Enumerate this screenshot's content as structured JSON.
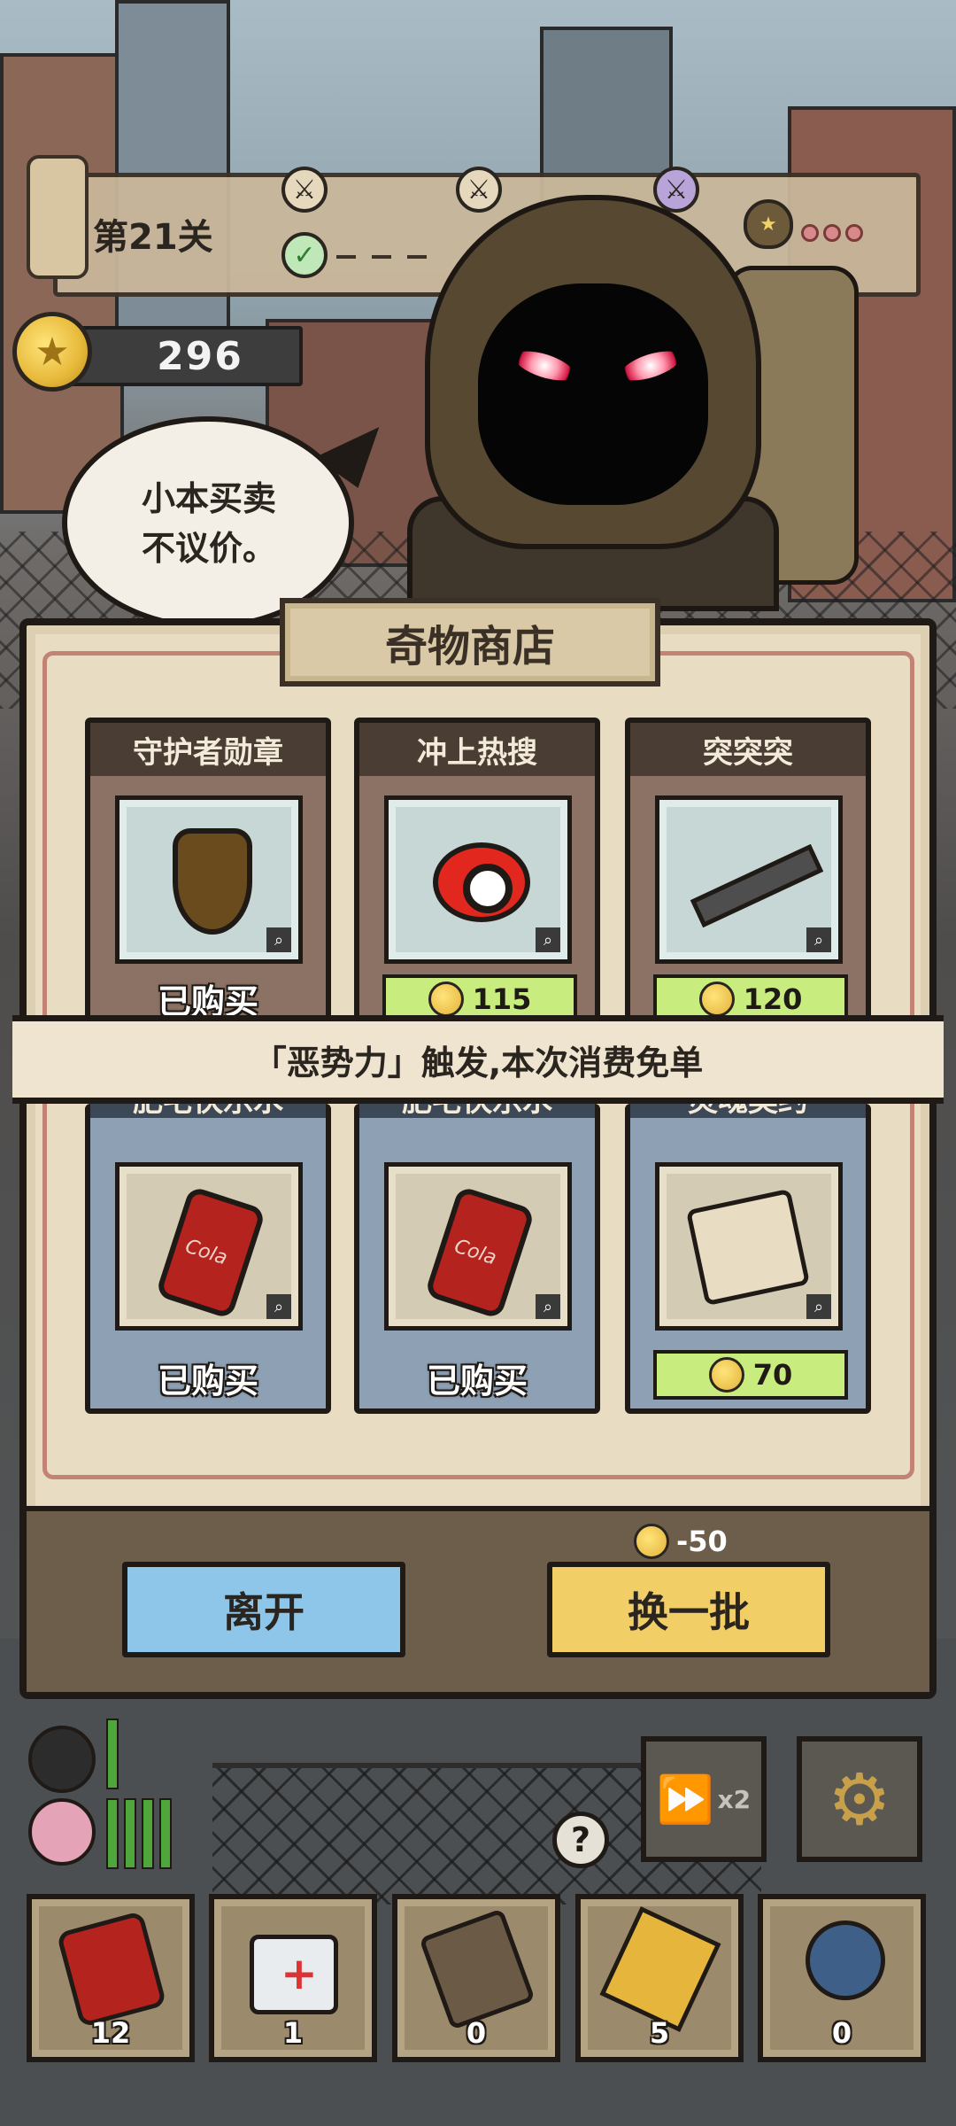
{
  "hud": {
    "level_title": "第21关",
    "coins": "296"
  },
  "merchant": {
    "speech": "小本买卖\n不议价。"
  },
  "shop": {
    "title": "奇物商店",
    "banner": "「恶势力」触发,本次消费免单",
    "items": [
      {
        "name": "守护者勋章",
        "status": "已购买",
        "price": null,
        "icon": "shield-medal-icon",
        "theme": "brown"
      },
      {
        "name": "冲上热搜",
        "status": null,
        "price": "115",
        "icon": "weibo-icon",
        "theme": "brown"
      },
      {
        "name": "突突突",
        "status": null,
        "price": "120",
        "icon": "rifle-icon",
        "theme": "brown"
      },
      {
        "name": "肥宅快乐水",
        "status": "已购买",
        "price": null,
        "icon": "cola-can-icon",
        "theme": "blue"
      },
      {
        "name": "肥宅快乐水",
        "status": "已购买",
        "price": null,
        "icon": "cola-can-icon",
        "theme": "blue"
      },
      {
        "name": "灵魂契约",
        "status": null,
        "price": "70",
        "icon": "scroll-contract-icon",
        "theme": "blue"
      }
    ],
    "leave_label": "离开",
    "refresh_label": "换一批",
    "refresh_cost": "-50"
  },
  "controls": {
    "speed_label": "x2",
    "help_label": "?"
  },
  "inventory": [
    {
      "icon": "cola-can-icon",
      "count": "12"
    },
    {
      "icon": "first-aid-kit-icon",
      "count": "1"
    },
    {
      "icon": "scroll-icon",
      "count": "0"
    },
    {
      "icon": "talisman-icon",
      "count": "5"
    },
    {
      "icon": "bomb-icon",
      "count": "0"
    }
  ],
  "colors": {
    "leave_button": "#8ec6ea",
    "refresh_button": "#f2ce67",
    "price_tag": "#c8ec7e"
  }
}
